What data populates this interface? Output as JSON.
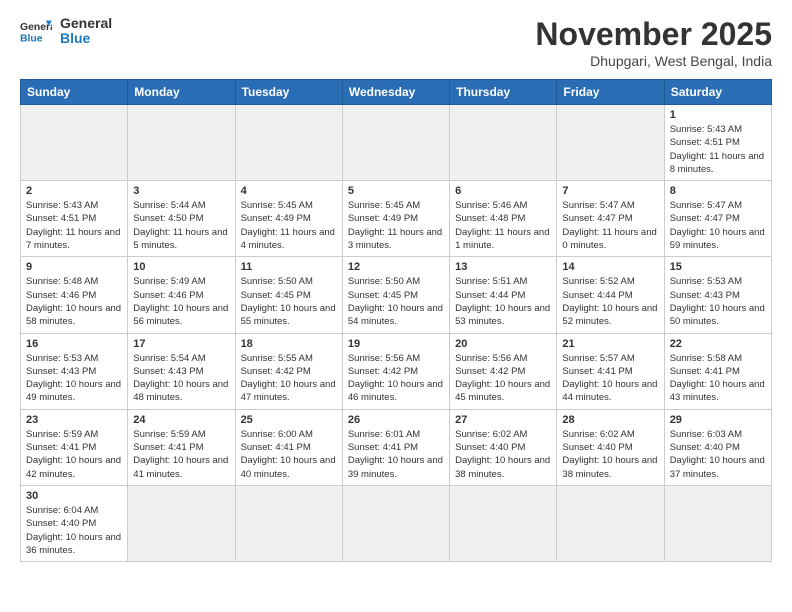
{
  "logo": {
    "text_general": "General",
    "text_blue": "Blue"
  },
  "header": {
    "month": "November 2025",
    "location": "Dhupgari, West Bengal, India"
  },
  "weekdays": [
    "Sunday",
    "Monday",
    "Tuesday",
    "Wednesday",
    "Thursday",
    "Friday",
    "Saturday"
  ],
  "days": [
    {
      "date": "",
      "info": ""
    },
    {
      "date": "",
      "info": ""
    },
    {
      "date": "",
      "info": ""
    },
    {
      "date": "",
      "info": ""
    },
    {
      "date": "",
      "info": ""
    },
    {
      "date": "",
      "info": ""
    },
    {
      "date": "1",
      "info": "Sunrise: 5:43 AM\nSunset: 4:51 PM\nDaylight: 11 hours and 8 minutes."
    },
    {
      "date": "2",
      "info": "Sunrise: 5:43 AM\nSunset: 4:51 PM\nDaylight: 11 hours and 7 minutes."
    },
    {
      "date": "3",
      "info": "Sunrise: 5:44 AM\nSunset: 4:50 PM\nDaylight: 11 hours and 5 minutes."
    },
    {
      "date": "4",
      "info": "Sunrise: 5:45 AM\nSunset: 4:49 PM\nDaylight: 11 hours and 4 minutes."
    },
    {
      "date": "5",
      "info": "Sunrise: 5:45 AM\nSunset: 4:49 PM\nDaylight: 11 hours and 3 minutes."
    },
    {
      "date": "6",
      "info": "Sunrise: 5:46 AM\nSunset: 4:48 PM\nDaylight: 11 hours and 1 minute."
    },
    {
      "date": "7",
      "info": "Sunrise: 5:47 AM\nSunset: 4:47 PM\nDaylight: 11 hours and 0 minutes."
    },
    {
      "date": "8",
      "info": "Sunrise: 5:47 AM\nSunset: 4:47 PM\nDaylight: 10 hours and 59 minutes."
    },
    {
      "date": "9",
      "info": "Sunrise: 5:48 AM\nSunset: 4:46 PM\nDaylight: 10 hours and 58 minutes."
    },
    {
      "date": "10",
      "info": "Sunrise: 5:49 AM\nSunset: 4:46 PM\nDaylight: 10 hours and 56 minutes."
    },
    {
      "date": "11",
      "info": "Sunrise: 5:50 AM\nSunset: 4:45 PM\nDaylight: 10 hours and 55 minutes."
    },
    {
      "date": "12",
      "info": "Sunrise: 5:50 AM\nSunset: 4:45 PM\nDaylight: 10 hours and 54 minutes."
    },
    {
      "date": "13",
      "info": "Sunrise: 5:51 AM\nSunset: 4:44 PM\nDaylight: 10 hours and 53 minutes."
    },
    {
      "date": "14",
      "info": "Sunrise: 5:52 AM\nSunset: 4:44 PM\nDaylight: 10 hours and 52 minutes."
    },
    {
      "date": "15",
      "info": "Sunrise: 5:53 AM\nSunset: 4:43 PM\nDaylight: 10 hours and 50 minutes."
    },
    {
      "date": "16",
      "info": "Sunrise: 5:53 AM\nSunset: 4:43 PM\nDaylight: 10 hours and 49 minutes."
    },
    {
      "date": "17",
      "info": "Sunrise: 5:54 AM\nSunset: 4:43 PM\nDaylight: 10 hours and 48 minutes."
    },
    {
      "date": "18",
      "info": "Sunrise: 5:55 AM\nSunset: 4:42 PM\nDaylight: 10 hours and 47 minutes."
    },
    {
      "date": "19",
      "info": "Sunrise: 5:56 AM\nSunset: 4:42 PM\nDaylight: 10 hours and 46 minutes."
    },
    {
      "date": "20",
      "info": "Sunrise: 5:56 AM\nSunset: 4:42 PM\nDaylight: 10 hours and 45 minutes."
    },
    {
      "date": "21",
      "info": "Sunrise: 5:57 AM\nSunset: 4:41 PM\nDaylight: 10 hours and 44 minutes."
    },
    {
      "date": "22",
      "info": "Sunrise: 5:58 AM\nSunset: 4:41 PM\nDaylight: 10 hours and 43 minutes."
    },
    {
      "date": "23",
      "info": "Sunrise: 5:59 AM\nSunset: 4:41 PM\nDaylight: 10 hours and 42 minutes."
    },
    {
      "date": "24",
      "info": "Sunrise: 5:59 AM\nSunset: 4:41 PM\nDaylight: 10 hours and 41 minutes."
    },
    {
      "date": "25",
      "info": "Sunrise: 6:00 AM\nSunset: 4:41 PM\nDaylight: 10 hours and 40 minutes."
    },
    {
      "date": "26",
      "info": "Sunrise: 6:01 AM\nSunset: 4:41 PM\nDaylight: 10 hours and 39 minutes."
    },
    {
      "date": "27",
      "info": "Sunrise: 6:02 AM\nSunset: 4:40 PM\nDaylight: 10 hours and 38 minutes."
    },
    {
      "date": "28",
      "info": "Sunrise: 6:02 AM\nSunset: 4:40 PM\nDaylight: 10 hours and 38 minutes."
    },
    {
      "date": "29",
      "info": "Sunrise: 6:03 AM\nSunset: 4:40 PM\nDaylight: 10 hours and 37 minutes."
    },
    {
      "date": "30",
      "info": "Sunrise: 6:04 AM\nSunset: 4:40 PM\nDaylight: 10 hours and 36 minutes."
    },
    {
      "date": "",
      "info": ""
    },
    {
      "date": "",
      "info": ""
    },
    {
      "date": "",
      "info": ""
    },
    {
      "date": "",
      "info": ""
    },
    {
      "date": "",
      "info": ""
    },
    {
      "date": "",
      "info": ""
    }
  ]
}
